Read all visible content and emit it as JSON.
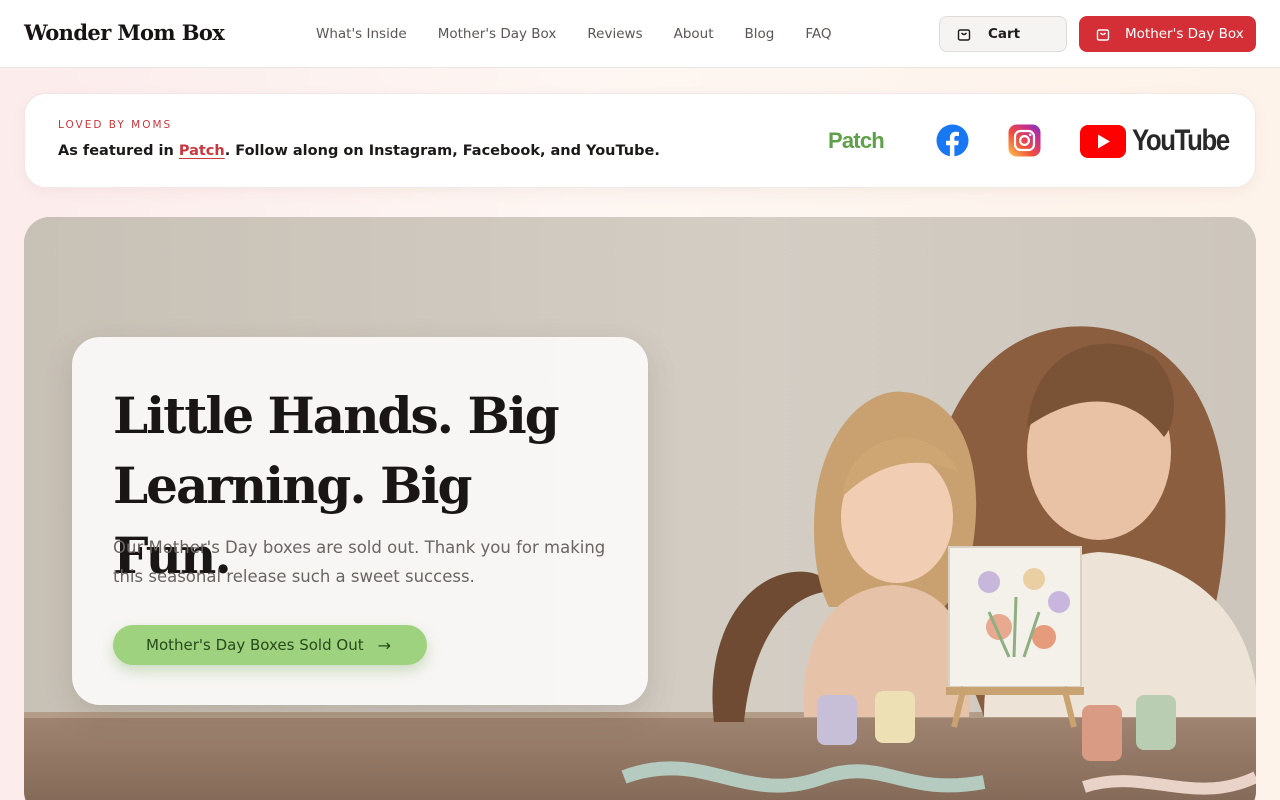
{
  "header": {
    "logo": "Wonder Mom Box",
    "nav": [
      "What's Inside",
      "Mother's Day Box",
      "Reviews",
      "About",
      "Blog",
      "FAQ"
    ],
    "cart_label": "Cart",
    "primary_label": "Mother's Day Box"
  },
  "featured": {
    "eyebrow": "LOVED BY MOMS",
    "text_prefix": "As featured in ",
    "link_text": "Patch",
    "text_suffix": ". Follow along on Instagram, Facebook, and YouTube.",
    "logos": {
      "patch": "Patch",
      "youtube": "YouTube"
    }
  },
  "hero": {
    "title": "Little Hands. Big Learning. Big Fun.",
    "subtitle": "Our Mother's Day boxes are sold out. Thank you for making this seasonal release such a sweet success.",
    "cta_label": "Mother's Day Boxes Sold Out",
    "cta_arrow": "→"
  },
  "colors": {
    "brand_red": "#d42f36",
    "cta_green": "#9ed27f",
    "patch_green": "#5fa04a",
    "facebook_blue": "#1877f2",
    "youtube_red": "#ff0000"
  }
}
